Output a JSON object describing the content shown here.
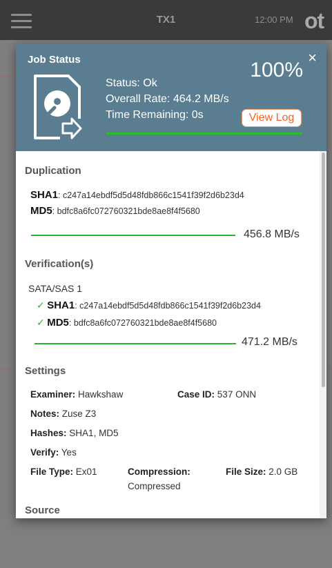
{
  "appbar": {
    "title": "TX1",
    "clock": "12:00 PM",
    "logo": "ot"
  },
  "job": {
    "title": "Job Status",
    "close": "×",
    "percent": "100%",
    "status": "Status: Ok",
    "overall_rate": "Overall Rate: 464.2 MB/s",
    "time_remaining": "Time Remaining: 0s",
    "view_log": "View Log",
    "progress": 1.0
  },
  "duplication": {
    "title": "Duplication",
    "sha1_label": "SHA1",
    "sha1_value": ": c247a14ebdf5d5d48fdb866c1541f39f2d6b23d4",
    "md5_label": "MD5",
    "md5_value": ": bdfc8a6fc072760321bde8ae8f4f5680",
    "rate": "456.8 MB/s"
  },
  "verification": {
    "title": "Verification(s)",
    "device": "SATA/SAS 1",
    "sha1_label": "SHA1",
    "sha1_value": ": c247a14ebdf5d5d48fdb866c1541f39f2d6b23d4",
    "md5_label": "MD5",
    "md5_value": ": bdfc8a6fc072760321bde8ae8f4f5680",
    "rate": "471.2 MB/s"
  },
  "settings": {
    "title": "Settings",
    "examiner_label": "Examiner:",
    "examiner": "Hawkshaw",
    "case_label": "Case ID:",
    "case_id": "537 ONN",
    "notes_label": "Notes:",
    "notes": "Zuse Z3",
    "hashes_label": "Hashes:",
    "hashes": "SHA1, MD5",
    "verify_label": "Verify:",
    "verify": "Yes",
    "filetype_label": "File Type:",
    "filetype": "Ex01",
    "compression_label": "Compression:",
    "compression": "Compressed",
    "filesize_label": "File Size:",
    "filesize": "2.0 GB"
  },
  "source": {
    "title": "Source"
  },
  "icons": {
    "menu": "hamburger-icon",
    "drive": "hard-drive-export-icon",
    "check": "checkmark-icon",
    "close": "close-icon"
  },
  "colors": {
    "header": "#5a7d92",
    "progress": "#26c02b",
    "accent": "#f26522"
  }
}
